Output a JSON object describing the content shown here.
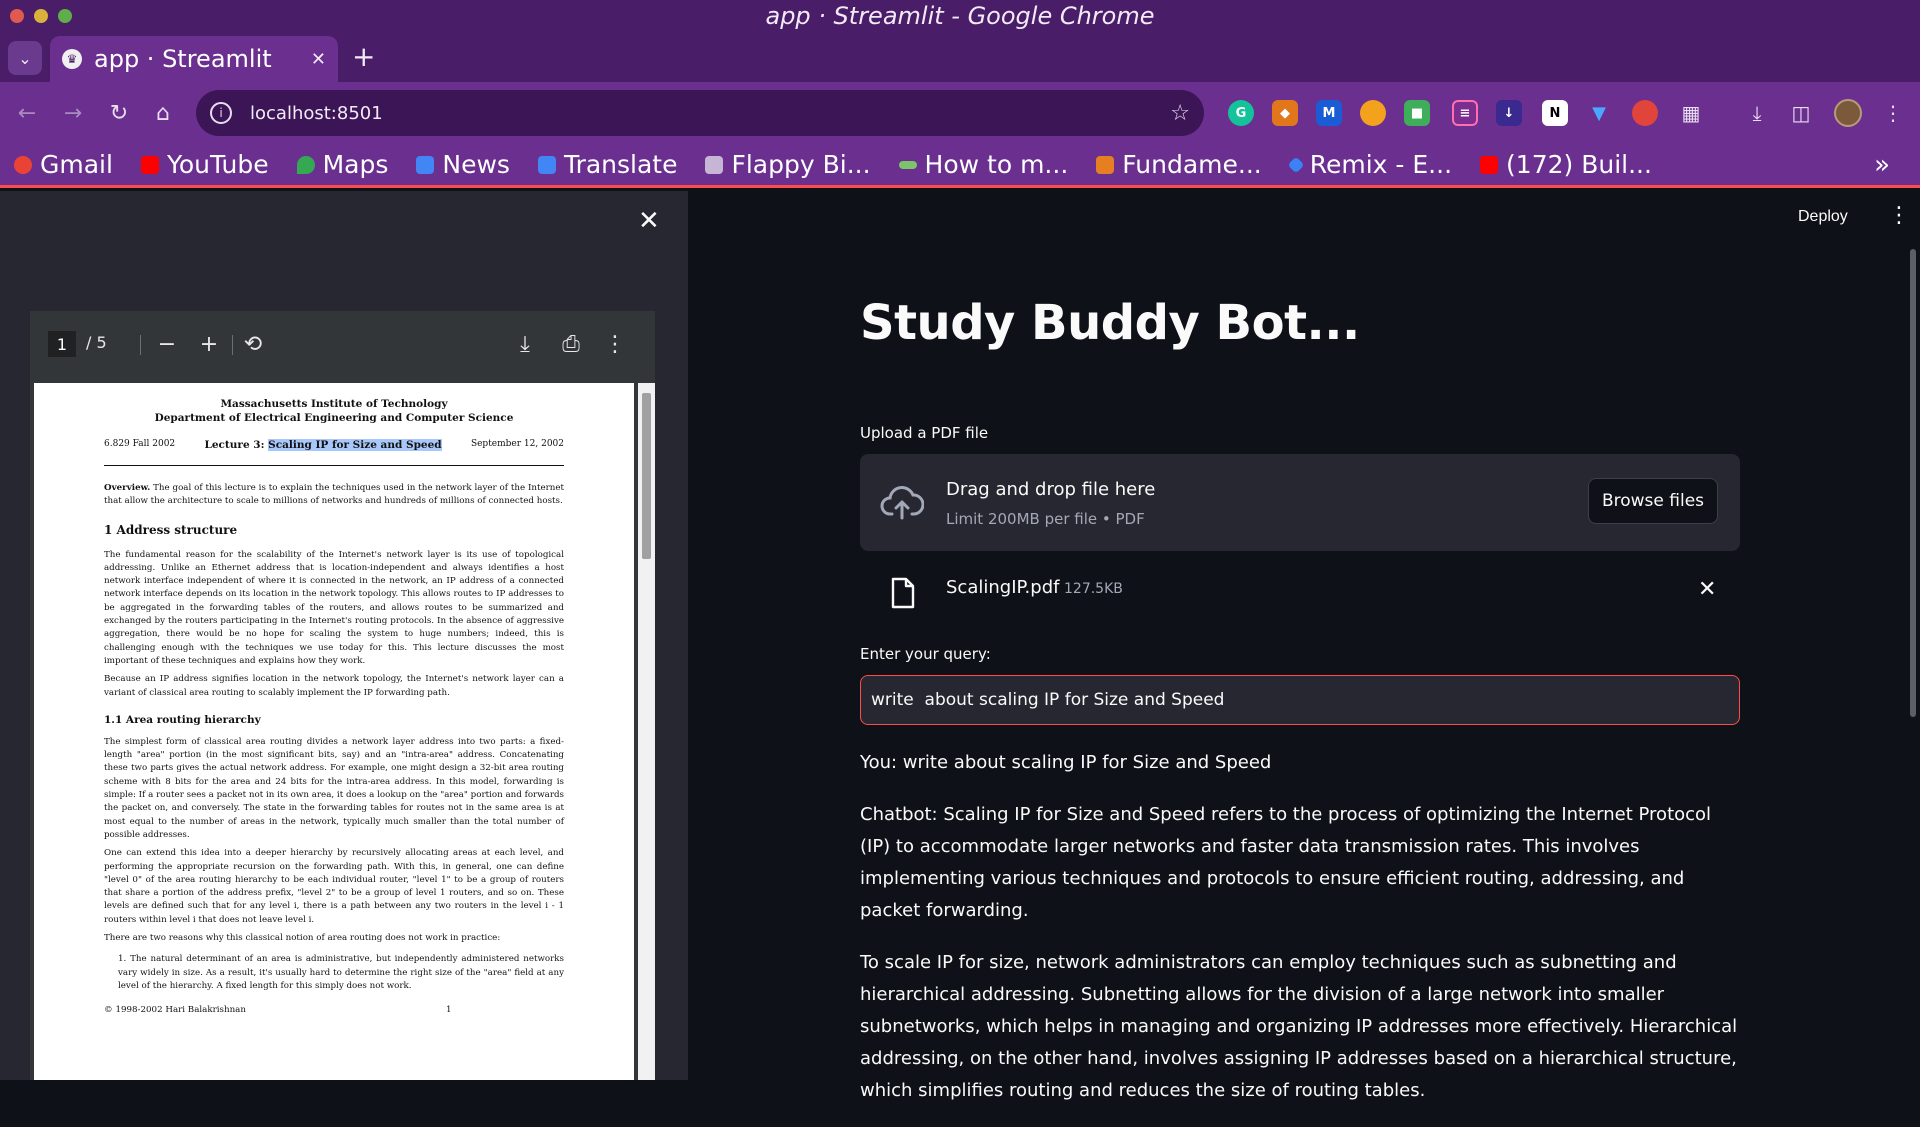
{
  "window": {
    "title": "app · Streamlit - Google Chrome"
  },
  "tab": {
    "title": "app · Streamlit",
    "favicon": "streamlit-crown"
  },
  "toolbar": {
    "url": "localhost:8501"
  },
  "bookmarks": [
    {
      "label": "Gmail",
      "color": "#ea4335"
    },
    {
      "label": "YouTube",
      "color": "#ff0000"
    },
    {
      "label": "Maps",
      "color": "#34a853"
    },
    {
      "label": "News",
      "color": "#4285f4"
    },
    {
      "label": "Translate",
      "color": "#4285f4"
    },
    {
      "label": "Flappy Bi...",
      "color": "#c7b5d6"
    },
    {
      "label": "How to m...",
      "color": "#7cc36a"
    },
    {
      "label": "Fundame...",
      "color": "#e67e22"
    },
    {
      "label": "Remix - E...",
      "color": "#3b82f6"
    },
    {
      "label": "(172) Buil...",
      "color": "#ff0000"
    }
  ],
  "pdf": {
    "current_page": "1",
    "page_count": "/ 5",
    "header_line1": "Massachusetts Institute of Technology",
    "header_line2": "Department of Electrical Engineering and Computer Science",
    "course": "6.829 Fall 2002",
    "lecture_prefix": "Lecture 3: ",
    "lecture_title": "Scaling IP for Size and Speed",
    "date": "September 12, 2002",
    "overview_label": "Overview.",
    "overview": "The goal of this lecture is to explain the techniques used in the network layer of the Internet that allow the architecture to scale to millions of networks and hundreds of millions of connected hosts.",
    "section1": "1   Address structure",
    "para1": "The fundamental reason for the scalability of the Internet's network layer is its use of topological addressing. Unlike an Ethernet address that is location-independent and always identifies a host network interface independent of where it is connected in the network, an IP address of a connected network interface depends on its location in the network topology. This allows routes to IP addresses to be aggregated in the forwarding tables of the routers, and allows routes to be summarized and exchanged by the routers participating in the Internet's routing protocols. In the absence of aggressive aggregation, there would be no hope for scaling the system to huge numbers; indeed, this is challenging enough with the techniques we use today for this. This lecture discusses the most important of these techniques and explains how they work.",
    "para2": "Because an IP address signifies location in the network topology, the Internet's network layer can a variant of classical area routing to scalably implement the IP forwarding path.",
    "subsection": "1.1   Area routing hierarchy",
    "para3": "The simplest form of classical area routing divides a network layer address into two parts: a fixed-length \"area\" portion (in the most significant bits, say) and an \"intra-area\" address. Concatenating these two parts gives the actual network address. For example, one might design a 32-bit area routing scheme with 8 bits for the area and 24 bits for the intra-area address. In this model, forwarding is simple: If a router sees a packet not in its own area, it does a lookup on the \"area\" portion and forwards the packet on, and conversely. The state in the forwarding tables for routes not in the same area is at most equal to the number of areas in the network, typically much smaller than the total number of possible addresses.",
    "para4": "One can extend this idea into a deeper hierarchy by recursively allocating areas at each level, and performing the appropriate recursion on the forwarding path. With this, in general, one can define \"level 0\" of the area routing hierarchy to be each individual router, \"level 1\" to be a group of routers that share a portion of the address prefix, \"level 2\" to be a group of level 1 routers, and so on. These levels are defined such that for any level i, there is a path between any two routers in the level i - 1 routers within level i that does not leave level i.",
    "para5": "There are two reasons why this classical notion of area routing does not work in practice:",
    "list1": "1. The natural determinant of an area is administrative, but independently administered networks vary widely in size. As a result, it's usually hard to determine the right size of the \"area\" field at any level of the hierarchy. A fixed length for this simply does not work.",
    "footer_left": "© 1998-2002 Hari Balakrishnan",
    "footer_page": "1"
  },
  "app": {
    "deploy_label": "Deploy",
    "title": "Study Buddy Bot...",
    "upload_label": "Upload a PDF file",
    "dropzone_title": "Drag and drop file here",
    "dropzone_limit": "Limit 200MB per file • PDF",
    "browse_label": "Browse files",
    "file_name": "ScalingIP.pdf",
    "file_size": "127.5KB",
    "query_label": "Enter your query:",
    "query_value": "write  about scaling IP for Size and Speed",
    "chat": [
      "You: write about scaling IP for Size and Speed",
      "Chatbot: Scaling IP for Size and Speed refers to the process of optimizing the Internet Protocol (IP) to accommodate larger networks and faster data transmission rates. This involves implementing various techniques and protocols to ensure efficient routing, addressing, and packet forwarding.",
      "To scale IP for size, network administrators can employ techniques such as subnetting and hierarchical addressing. Subnetting allows for the division of a large network into smaller subnetworks, which helps in managing and organizing IP addresses more effectively. Hierarchical addressing, on the other hand, involves assigning IP addresses based on a hierarchical structure, which simplifies routing and reduces the size of routing tables."
    ]
  },
  "colors": {
    "accent": "#ff4b4b",
    "chrome_purple": "#6a2f8f",
    "app_bg": "#0e1117",
    "sidebar_bg": "#262730"
  }
}
